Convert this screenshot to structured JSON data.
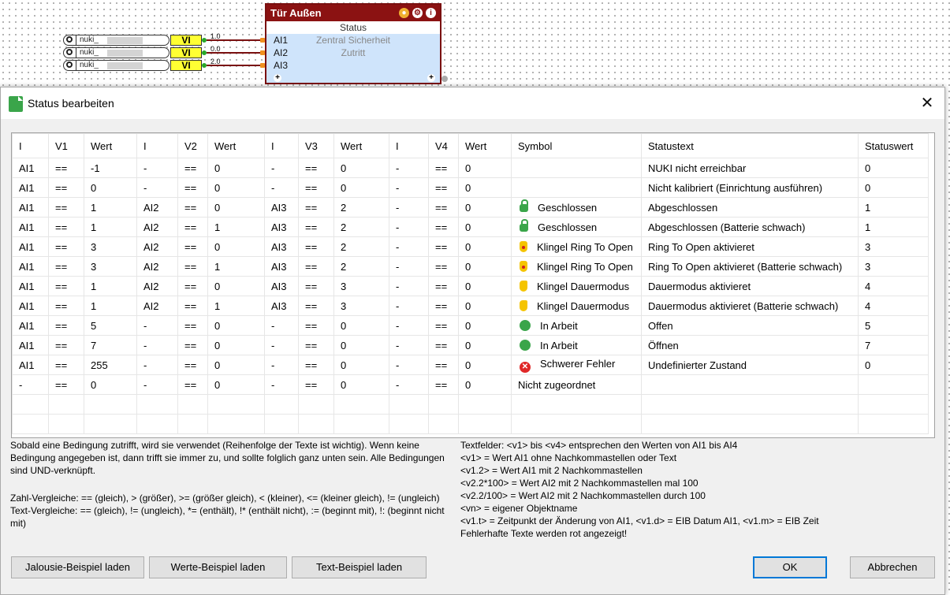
{
  "canvas": {
    "inputs": [
      {
        "name": "nuki_",
        "vi_label": "VI",
        "wire_value": "1.0"
      },
      {
        "name": "nuki_",
        "vi_label": "VI",
        "wire_value": "0.0"
      },
      {
        "name": "nuki_",
        "vi_label": "VI",
        "wire_value": "2.0"
      }
    ],
    "block": {
      "title": "Tür Außen",
      "status_label": "Status",
      "ports": [
        {
          "label": "AI1",
          "value": "Zentral Sicherheit"
        },
        {
          "label": "AI2",
          "value": "Zutritt"
        },
        {
          "label": "AI3",
          "value": ""
        }
      ],
      "plus": "+",
      "icons": [
        "bulb-icon",
        "gear-icon",
        "info-icon"
      ]
    }
  },
  "dialog": {
    "title": "Status bearbeiten",
    "close": "✕",
    "columns": [
      "I",
      "V1",
      "Wert",
      "I",
      "V2",
      "Wert",
      "I",
      "V3",
      "Wert",
      "I",
      "V4",
      "Wert",
      "Symbol",
      "Statustext",
      "Statuswert"
    ],
    "rows": [
      {
        "c": [
          "AI1",
          "==",
          "-1",
          "-",
          "==",
          "0",
          "-",
          "==",
          "0",
          "-",
          "==",
          "0"
        ],
        "symbol": "none",
        "symbol_text": "",
        "statustext": "NUKI nicht erreichbar",
        "statuswert": "0"
      },
      {
        "c": [
          "AI1",
          "==",
          "0",
          "-",
          "==",
          "0",
          "-",
          "==",
          "0",
          "-",
          "==",
          "0"
        ],
        "symbol": "none",
        "symbol_text": "",
        "statustext": "Nicht kalibriert (Einrichtung ausführen)",
        "statuswert": "0"
      },
      {
        "c": [
          "AI1",
          "==",
          "1",
          "AI2",
          "==",
          "0",
          "AI3",
          "==",
          "2",
          "-",
          "==",
          "0"
        ],
        "symbol": "lock",
        "symbol_text": "Geschlossen",
        "statustext": "Abgeschlossen",
        "statuswert": "1"
      },
      {
        "c": [
          "AI1",
          "==",
          "1",
          "AI2",
          "==",
          "1",
          "AI3",
          "==",
          "2",
          "-",
          "==",
          "0"
        ],
        "symbol": "lock",
        "symbol_text": "Geschlossen",
        "statustext": "Abgeschlossen (Batterie schwach)",
        "statuswert": "1"
      },
      {
        "c": [
          "AI1",
          "==",
          "3",
          "AI2",
          "==",
          "0",
          "AI3",
          "==",
          "2",
          "-",
          "==",
          "0"
        ],
        "symbol": "bell",
        "symbol_text": "Klingel Ring To Open",
        "statustext": "Ring To Open aktivieret",
        "statuswert": "3"
      },
      {
        "c": [
          "AI1",
          "==",
          "3",
          "AI2",
          "==",
          "1",
          "AI3",
          "==",
          "2",
          "-",
          "==",
          "0"
        ],
        "symbol": "bell",
        "symbol_text": "Klingel Ring To Open",
        "statustext": "Ring To Open aktivieret (Batterie schwach)",
        "statuswert": "3"
      },
      {
        "c": [
          "AI1",
          "==",
          "1",
          "AI2",
          "==",
          "0",
          "AI3",
          "==",
          "3",
          "-",
          "==",
          "0"
        ],
        "symbol": "hand",
        "symbol_text": "Klingel Dauermodus",
        "statustext": "Dauermodus aktivieret",
        "statuswert": "4"
      },
      {
        "c": [
          "AI1",
          "==",
          "1",
          "AI2",
          "==",
          "1",
          "AI3",
          "==",
          "3",
          "-",
          "==",
          "0"
        ],
        "symbol": "hand",
        "symbol_text": "Klingel Dauermodus",
        "statustext": "Dauermodus aktivieret (Batterie schwach)",
        "statuswert": "4"
      },
      {
        "c": [
          "AI1",
          "==",
          "5",
          "-",
          "==",
          "0",
          "-",
          "==",
          "0",
          "-",
          "==",
          "0"
        ],
        "symbol": "gear",
        "symbol_text": "In Arbeit",
        "statustext": "Offen",
        "statuswert": "5"
      },
      {
        "c": [
          "AI1",
          "==",
          "7",
          "-",
          "==",
          "0",
          "-",
          "==",
          "0",
          "-",
          "==",
          "0"
        ],
        "symbol": "gear",
        "symbol_text": "In Arbeit",
        "statustext": "Öffnen",
        "statuswert": "7"
      },
      {
        "c": [
          "AI1",
          "==",
          "255",
          "-",
          "==",
          "0",
          "-",
          "==",
          "0",
          "-",
          "==",
          "0"
        ],
        "symbol": "err",
        "symbol_text": "Schwerer Fehler",
        "statustext": "Undefinierter Zustand",
        "statuswert": "0"
      },
      {
        "c": [
          "-",
          "==",
          "0",
          "-",
          "==",
          "0",
          "-",
          "==",
          "0",
          "-",
          "==",
          "0"
        ],
        "symbol": "none",
        "symbol_text": "Nicht zugeordnet",
        "statustext": "",
        "statuswert": ""
      }
    ],
    "empty_rows": 2,
    "help_left_1": "Sobald eine Bedingung zutrifft, wird sie verwendet (Reihenfolge der Texte ist wichtig). Wenn keine Bedingung angegeben ist, dann trifft sie immer zu, und sollte folglich ganz unten sein. Alle Bedingungen sind UND-verknüpft.",
    "help_left_2": "Zahl-Vergleiche: == (gleich), > (größer), >= (größer gleich), < (kleiner), <= (kleiner gleich), != (ungleich)\nText-Vergleiche: == (gleich), != (ungleich), *= (enthält), !* (enthält nicht), := (beginnt mit), !: (beginnt nicht mit)",
    "help_right": "Textfelder: <v1> bis <v4> entsprechen den Werten von AI1 bis AI4\n<v1> = Wert AI1 ohne Nachkommastellen oder Text\n<v1.2> = Wert AI1 mit 2 Nachkommastellen\n<v2.2*100> = Wert AI2 mit 2 Nachkommastellen mal 100\n<v2.2/100> = Wert AI2 mit 2 Nachkommastellen durch 100\n<vn> = eigener Objektname\n<v1.t> = Zeitpunkt der Änderung von AI1, <v1.d> = EIB Datum AI1, <v1.m> = EIB Zeit\nFehlerhafte Texte werden rot angezeigt!",
    "buttons": {
      "jalousie": "Jalousie-Beispiel laden",
      "werte": "Werte-Beispiel laden",
      "text": "Text-Beispiel laden",
      "ok": "OK",
      "cancel": "Abbrechen"
    }
  }
}
